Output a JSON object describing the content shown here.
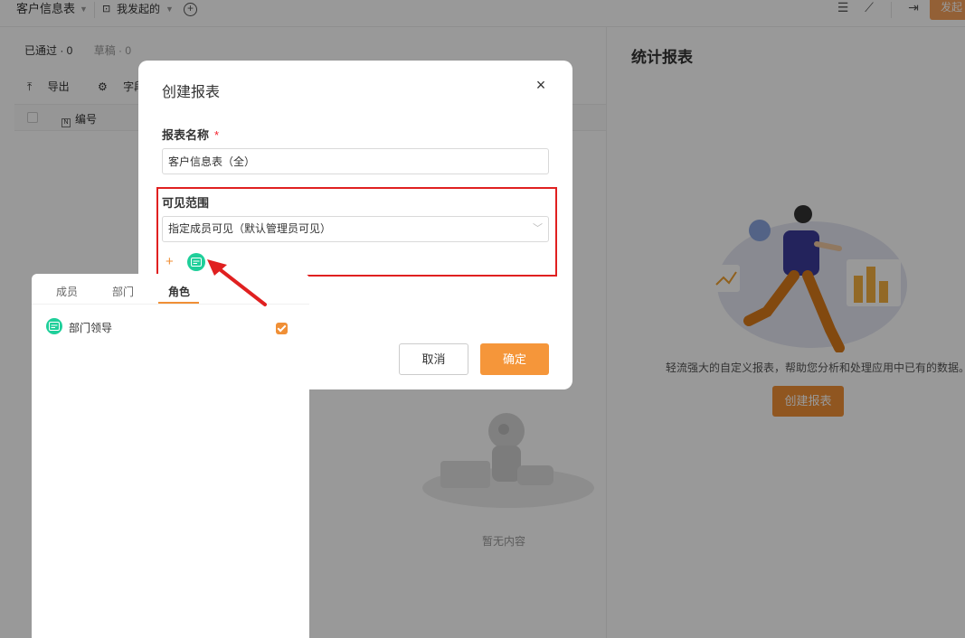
{
  "topbar": {
    "title": "客户信息表",
    "filter": "我发起的",
    "action_right": "发起"
  },
  "main": {
    "tabs": [
      "已通过 · 0",
      "草稿 · 0"
    ],
    "toolbar": [
      "导出",
      "字段管理"
    ],
    "table_header": "编号",
    "empty_text": "暂无内容"
  },
  "report_panel": {
    "title": "统计报表",
    "description": "轻流强大的自定义报表，帮助您分析和处理应用中已有的数据。",
    "create_button": "创建报表"
  },
  "modal": {
    "title": "创建报表",
    "name_label": "报表名称",
    "required_mark": "*",
    "name_value": "客户信息表（全）",
    "scope_label": "可见范围",
    "scope_value": "指定成员可见（默认管理员可见）",
    "add_symbol": "+",
    "cancel": "取消",
    "confirm": "确定"
  },
  "picker": {
    "tabs": [
      "成员",
      "部门",
      "角色"
    ],
    "active_tab": "角色",
    "items": [
      {
        "label": "部门领导",
        "checked": true
      }
    ]
  },
  "colors": {
    "accent": "#f08f36",
    "role_chip": "#1fcf9a",
    "highlight": "#e02020"
  }
}
